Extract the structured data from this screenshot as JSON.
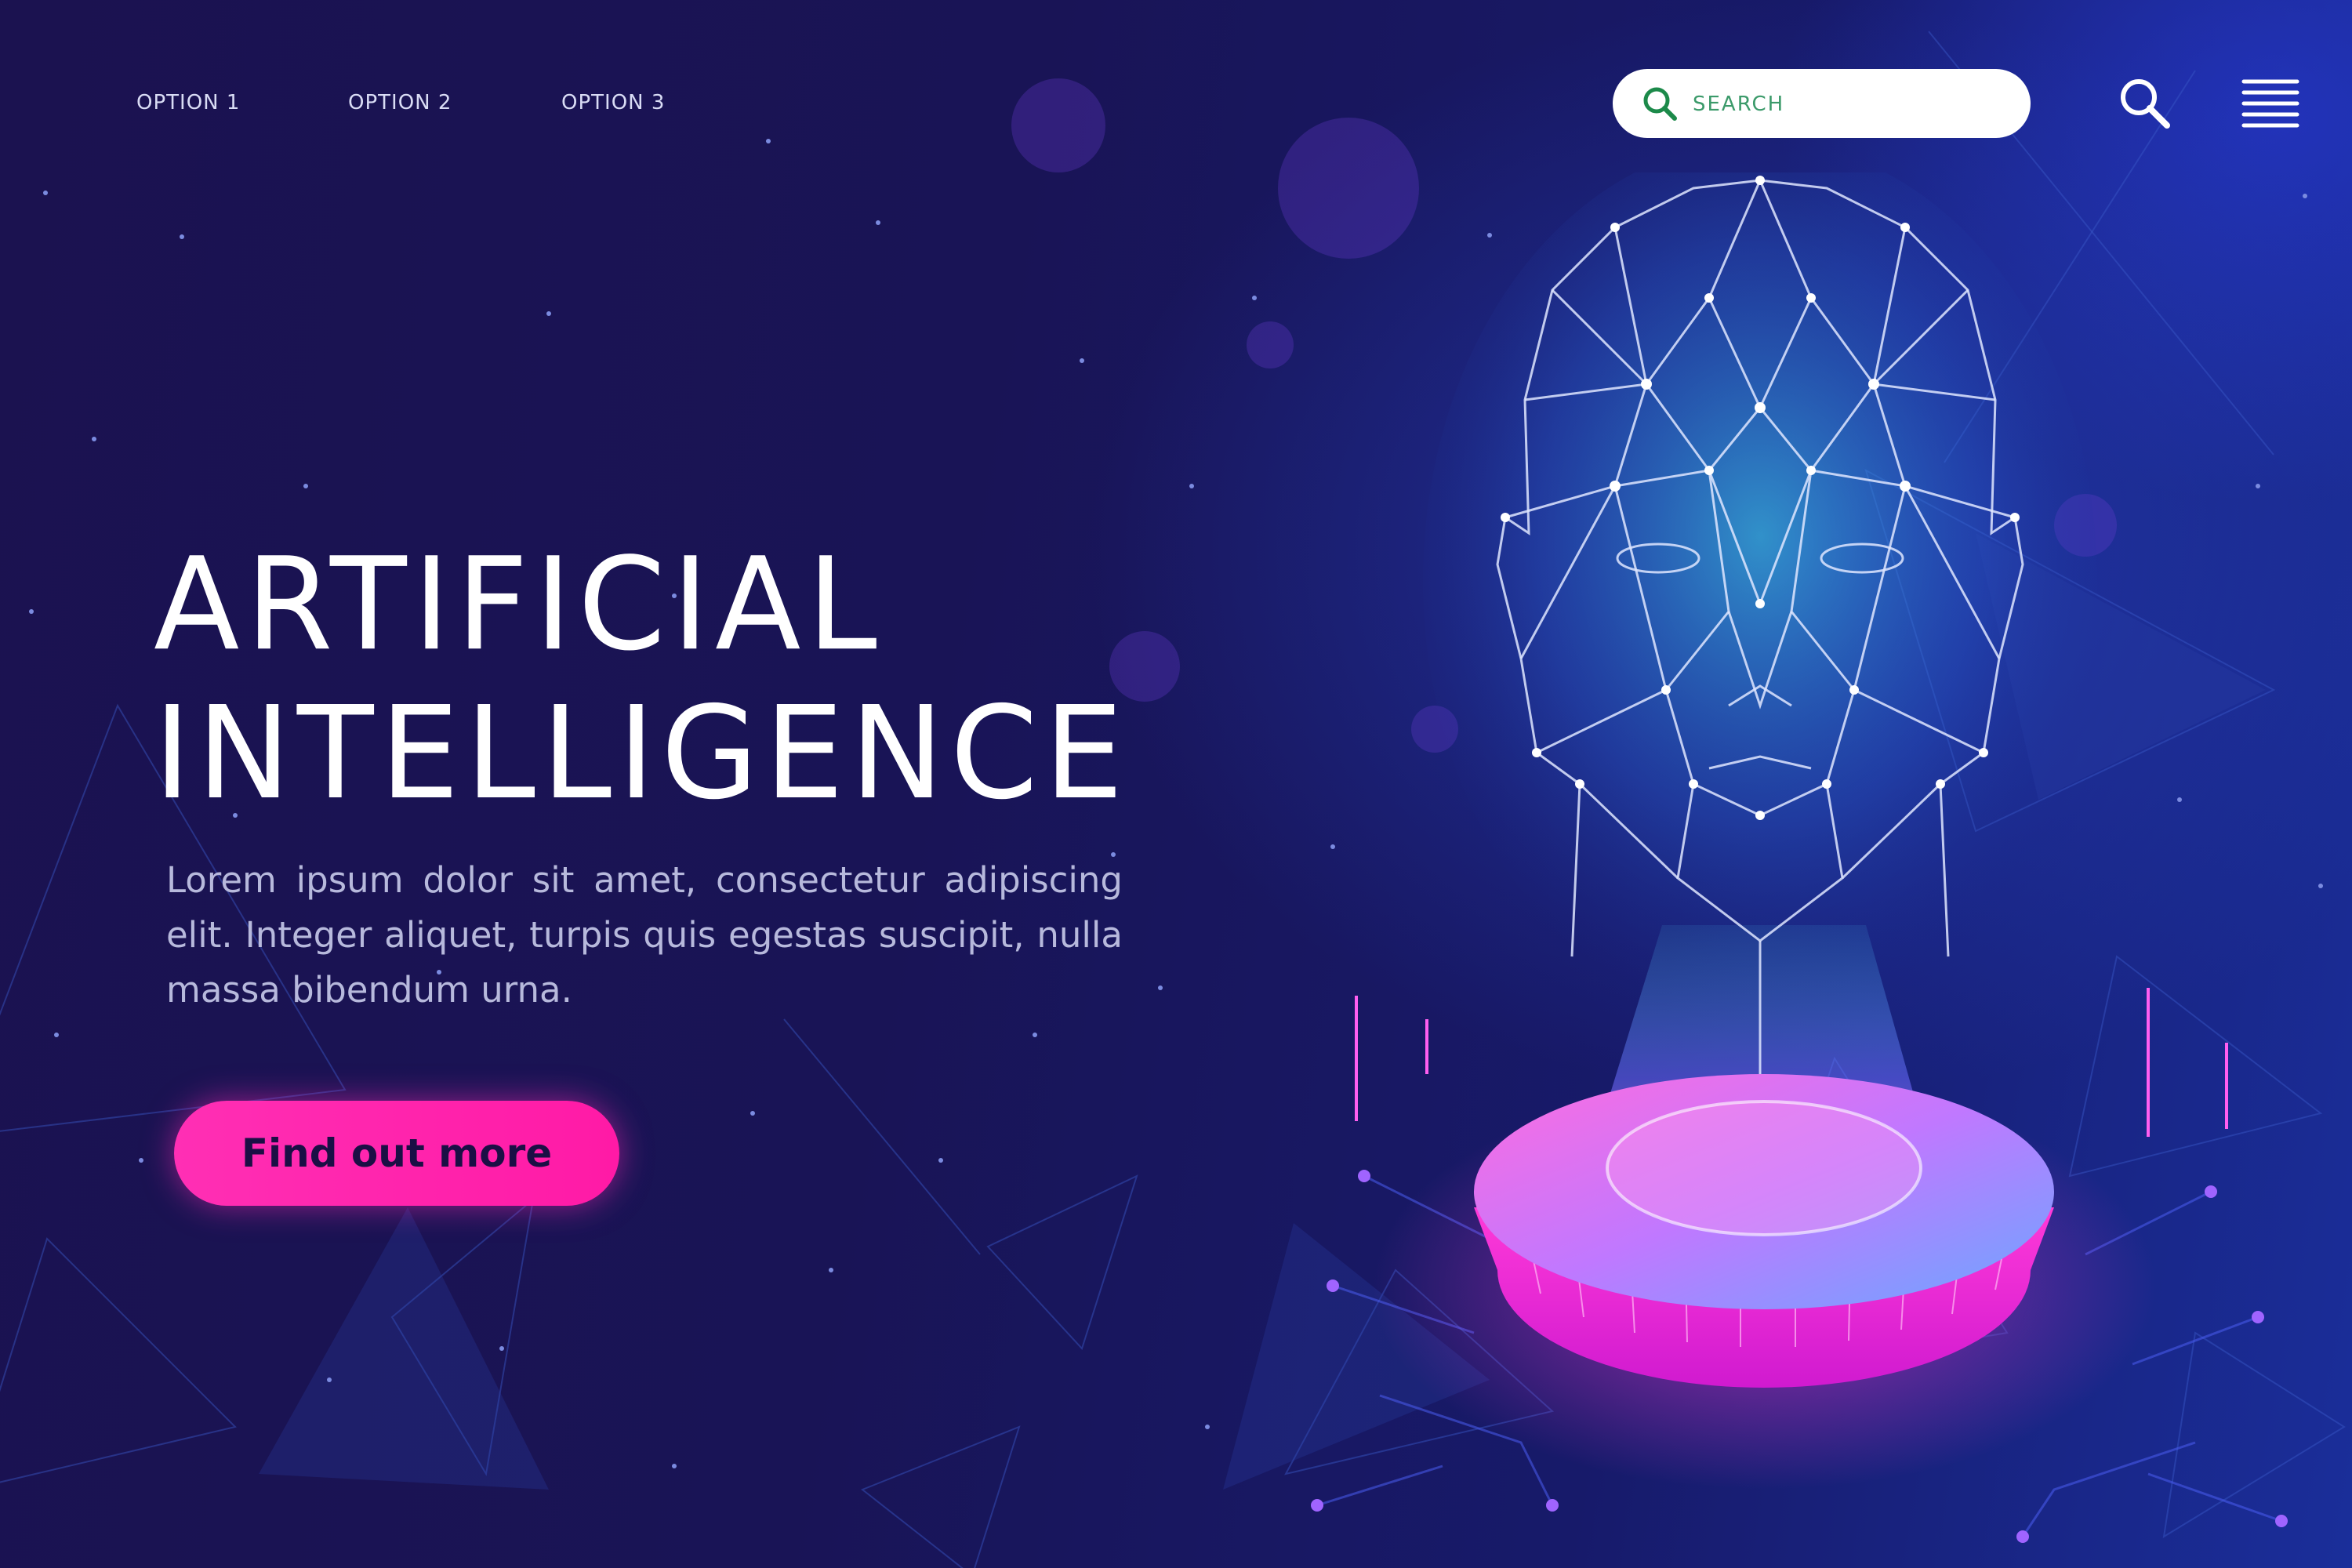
{
  "nav": {
    "links": [
      {
        "label": "OPTION 1"
      },
      {
        "label": "OPTION 2"
      },
      {
        "label": "OPTION 3"
      }
    ]
  },
  "search": {
    "placeholder": "SEARCH",
    "value": ""
  },
  "hero": {
    "title_line1": "ARTIFICIAL",
    "title_line2": "INTELLIGENCE",
    "description": "Lorem ipsum dolor sit amet, consectetur adipiscing elit. Integer aliquet, turpis quis egestas suscipit, nulla massa bibendum urna.",
    "cta_label": "Find out more"
  },
  "icons": {
    "search": "search-icon",
    "magnifier": "magnifier-icon",
    "menu": "hamburger-menu-icon",
    "illustration": "ai-head-hologram"
  },
  "colors": {
    "background": "#170f4a",
    "accent_pink": "#ff1aa6",
    "search_green": "#2c8a5a",
    "hologram_cyan": "#3fe6ff"
  }
}
